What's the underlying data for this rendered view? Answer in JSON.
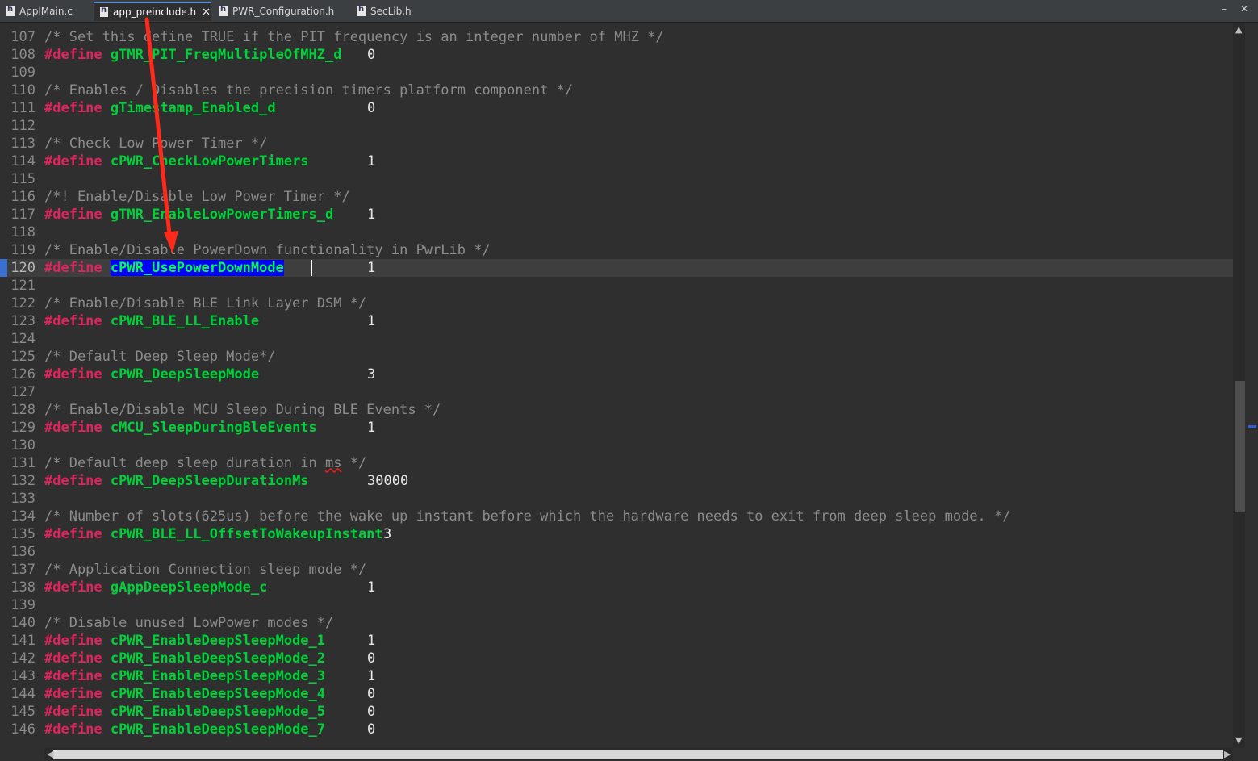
{
  "tabs": [
    {
      "label": "ApplMain.c",
      "active": false
    },
    {
      "label": "app_preinclude.h",
      "active": true
    },
    {
      "label": "PWR_Configuration.h",
      "active": false
    },
    {
      "label": "SecLib.h",
      "active": false
    }
  ],
  "window": {
    "minimize": "–",
    "close": "✕"
  },
  "editor": {
    "selected_token": "cPWR_UsePowerDownMode",
    "current_line": "120",
    "lines": [
      {
        "n": "107",
        "comment": "/* Set this define TRUE if the PIT frequency is an integer number of MHZ */"
      },
      {
        "n": "108",
        "kw": "#define",
        "name": "gTMR_PIT_FreqMultipleOfMHZ_d",
        "val": "0"
      },
      {
        "n": "109"
      },
      {
        "n": "110",
        "comment": "/* Enables / Disables the precision timers platform component */"
      },
      {
        "n": "111",
        "kw": "#define",
        "name": "gTimestamp_Enabled_d",
        "val": "0"
      },
      {
        "n": "112"
      },
      {
        "n": "113",
        "comment": "/* Check Low Power Timer */"
      },
      {
        "n": "114",
        "kw": "#define",
        "name": "cPWR_CheckLowPowerTimers",
        "val": "1"
      },
      {
        "n": "115"
      },
      {
        "n": "116",
        "comment": "/*! Enable/Disable Low Power Timer */"
      },
      {
        "n": "117",
        "kw": "#define",
        "name": "gTMR_EnableLowPowerTimers_d",
        "val": "1"
      },
      {
        "n": "118"
      },
      {
        "n": "119",
        "comment": "/* Enable/Disable PowerDown functionality in PwrLib */"
      },
      {
        "n": "120",
        "kw": "#define",
        "name": "cPWR_UsePowerDownMode",
        "val": "1"
      },
      {
        "n": "121"
      },
      {
        "n": "122",
        "comment": "/* Enable/Disable BLE Link Layer DSM */"
      },
      {
        "n": "123",
        "kw": "#define",
        "name": "cPWR_BLE_LL_Enable",
        "val": "1"
      },
      {
        "n": "124"
      },
      {
        "n": "125",
        "comment": "/* Default Deep Sleep Mode*/"
      },
      {
        "n": "126",
        "kw": "#define",
        "name": "cPWR_DeepSleepMode",
        "val": "3"
      },
      {
        "n": "127"
      },
      {
        "n": "128",
        "comment": "/* Enable/Disable MCU Sleep During BLE Events */"
      },
      {
        "n": "129",
        "kw": "#define",
        "name": "cMCU_SleepDuringBleEvents",
        "val": "1"
      },
      {
        "n": "130"
      },
      {
        "n": "131",
        "comment": "/* Default deep sleep duration in ms */"
      },
      {
        "n": "132",
        "kw": "#define",
        "name": "cPWR_DeepSleepDurationMs",
        "val": "30000"
      },
      {
        "n": "133"
      },
      {
        "n": "134",
        "comment": "/* Number of slots(625us) before the wake up instant before which the hardware needs to exit from deep sleep mode. */"
      },
      {
        "n": "135",
        "kw": "#define",
        "name": "cPWR_BLE_LL_OffsetToWakeupInstant",
        "val": "3"
      },
      {
        "n": "136"
      },
      {
        "n": "137",
        "comment": "/* Application Connection sleep mode */"
      },
      {
        "n": "138",
        "kw": "#define",
        "name": "gAppDeepSleepMode_c",
        "val": "1"
      },
      {
        "n": "139"
      },
      {
        "n": "140",
        "comment": "/* Disable unused LowPower modes */"
      },
      {
        "n": "141",
        "kw": "#define",
        "name": "cPWR_EnableDeepSleepMode_1",
        "val": "1"
      },
      {
        "n": "142",
        "kw": "#define",
        "name": "cPWR_EnableDeepSleepMode_2",
        "val": "0"
      },
      {
        "n": "143",
        "kw": "#define",
        "name": "cPWR_EnableDeepSleepMode_3",
        "val": "1"
      },
      {
        "n": "144",
        "kw": "#define",
        "name": "cPWR_EnableDeepSleepMode_4",
        "val": "0"
      },
      {
        "n": "145",
        "kw": "#define",
        "name": "cPWR_EnableDeepSleepMode_5",
        "val": "0"
      },
      {
        "n": "146",
        "kw": "#define",
        "name": "cPWR_EnableDeepSleepMode_7",
        "val": "0"
      }
    ]
  },
  "colors": {
    "background": "#2f2f2f",
    "keyword": "#e0245e",
    "macro_name": "#00d13a",
    "comment": "#8c8c8c",
    "selection": "#0000ff",
    "annotation_arrow": "#ff2a1a"
  }
}
